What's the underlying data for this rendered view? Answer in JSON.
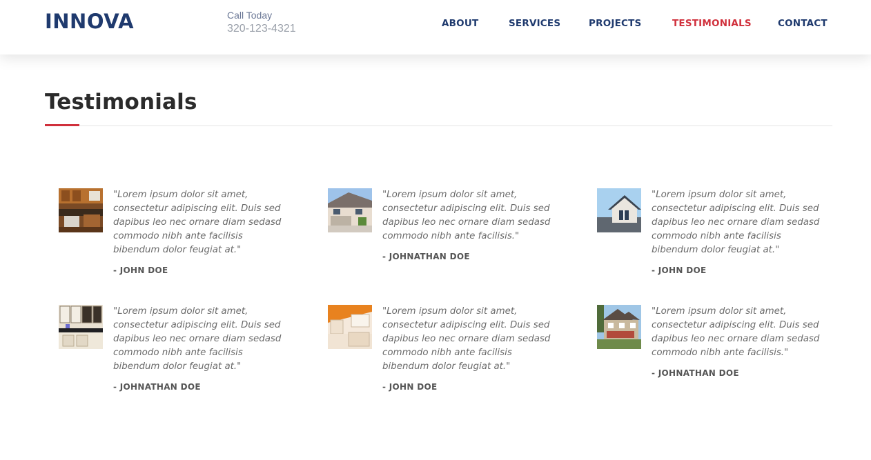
{
  "header": {
    "logo": "INNOVA",
    "call_label": "Call Today",
    "phone": "320-123-4321",
    "nav": [
      {
        "label": "ABOUT",
        "active": false
      },
      {
        "label": "SERVICES",
        "active": false
      },
      {
        "label": "PROJECTS",
        "active": false
      },
      {
        "label": "TESTIMONIALS",
        "active": true
      },
      {
        "label": "CONTACT",
        "active": false
      }
    ]
  },
  "page": {
    "title": "Testimonials"
  },
  "colors": {
    "brand": "#1f3a6e",
    "accent": "#d0303c"
  },
  "testimonials": [
    {
      "quote": "\"Lorem ipsum dolor sit amet, consectetur adipiscing elit. Duis sed dapibus leo nec ornare diam sedasd commodo nibh ante facilisis bibendum dolor feugiat at.\"",
      "author": "- JOHN DOE",
      "image": "kitchen-photo"
    },
    {
      "quote": "\"Lorem ipsum dolor sit amet, consectetur adipiscing elit. Duis sed dapibus leo nec ornare diam sedasd commodo nibh ante facilisis.\"",
      "author": "- JOHNATHAN DOE",
      "image": "house-garage-photo"
    },
    {
      "quote": "\"Lorem ipsum dolor sit amet, consectetur adipiscing elit. Duis sed dapibus leo nec ornare diam sedasd commodo nibh ante facilisis bibendum dolor feugiat at.\"",
      "author": "- JOHN DOE",
      "image": "roof-dormer-photo"
    },
    {
      "quote": "\"Lorem ipsum dolor sit amet, consectetur adipiscing elit. Duis sed dapibus leo nec ornare diam sedasd commodo nibh ante facilisis bibendum dolor feugiat at.\"",
      "author": "- JOHNATHAN DOE",
      "image": "kitchen-cabinets-photo"
    },
    {
      "quote": "\"Lorem ipsum dolor sit amet, consectetur adipiscing elit. Duis sed dapibus leo nec ornare diam sedasd commodo nibh ante facilisis bibendum dolor feugiat at.\"",
      "author": "- JOHN DOE",
      "image": "bright-kitchen-photo"
    },
    {
      "quote": "\"Lorem ipsum dolor sit amet, consectetur adipiscing elit. Duis sed dapibus leo nec ornare diam sedasd commodo nibh ante facilisis.\"",
      "author": "- JOHNATHAN DOE",
      "image": "house-exterior-photo"
    }
  ]
}
